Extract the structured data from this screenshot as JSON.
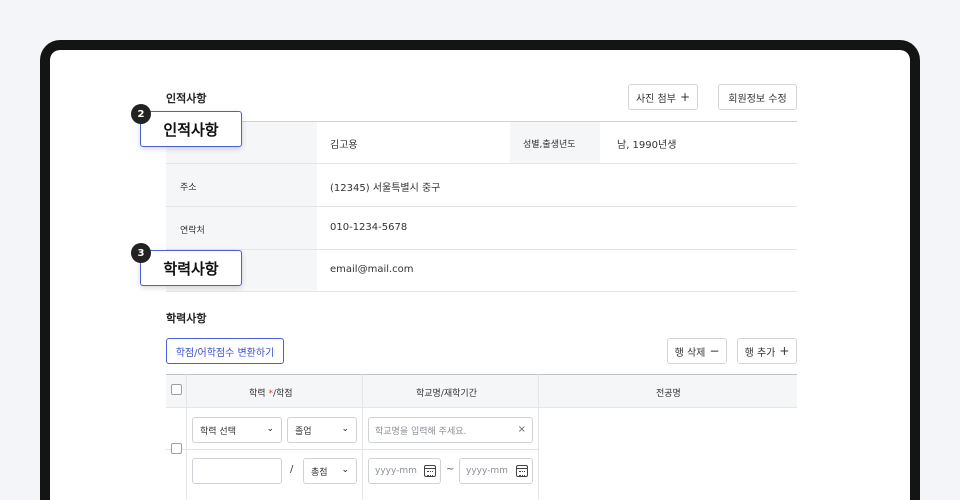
{
  "personal": {
    "title": "인적사항",
    "attach_photo_label": "사진 첨부",
    "edit_member_label": "회원정보 수정",
    "name_value": "김고용",
    "gender_birth_label": "성별,출생년도",
    "gender_birth_value": "남, 1990년생",
    "address_label": "주소",
    "address_value": "(12345) 서울특별시 중구",
    "contact_label": "연락처",
    "contact_value": "010-1234-5678",
    "email_value": "email@mail.com"
  },
  "callouts": [
    {
      "number": "2",
      "text": "인적사항"
    },
    {
      "number": "3",
      "text": "학력사항"
    }
  ],
  "education": {
    "title": "학력사항",
    "convert_button": "학점/어학점수 변환하기",
    "delete_row_label": "행 삭제",
    "add_row_label": "행 추가",
    "columns": {
      "degree_label": "학력",
      "required_mark": "*",
      "degree_suffix": "/학점",
      "school_period": "학교명/재학기간",
      "major": "전공명"
    },
    "row": {
      "degree_select": "학력 선택",
      "status_select": "졸업",
      "school_placeholder": "학교명을 입력해 주세요.",
      "gpa_value": "",
      "slash": "/",
      "total_select": "총점",
      "start_date_placeholder": "yyyy-mm",
      "tilde": "~",
      "end_date_placeholder": "yyyy-mm"
    }
  }
}
